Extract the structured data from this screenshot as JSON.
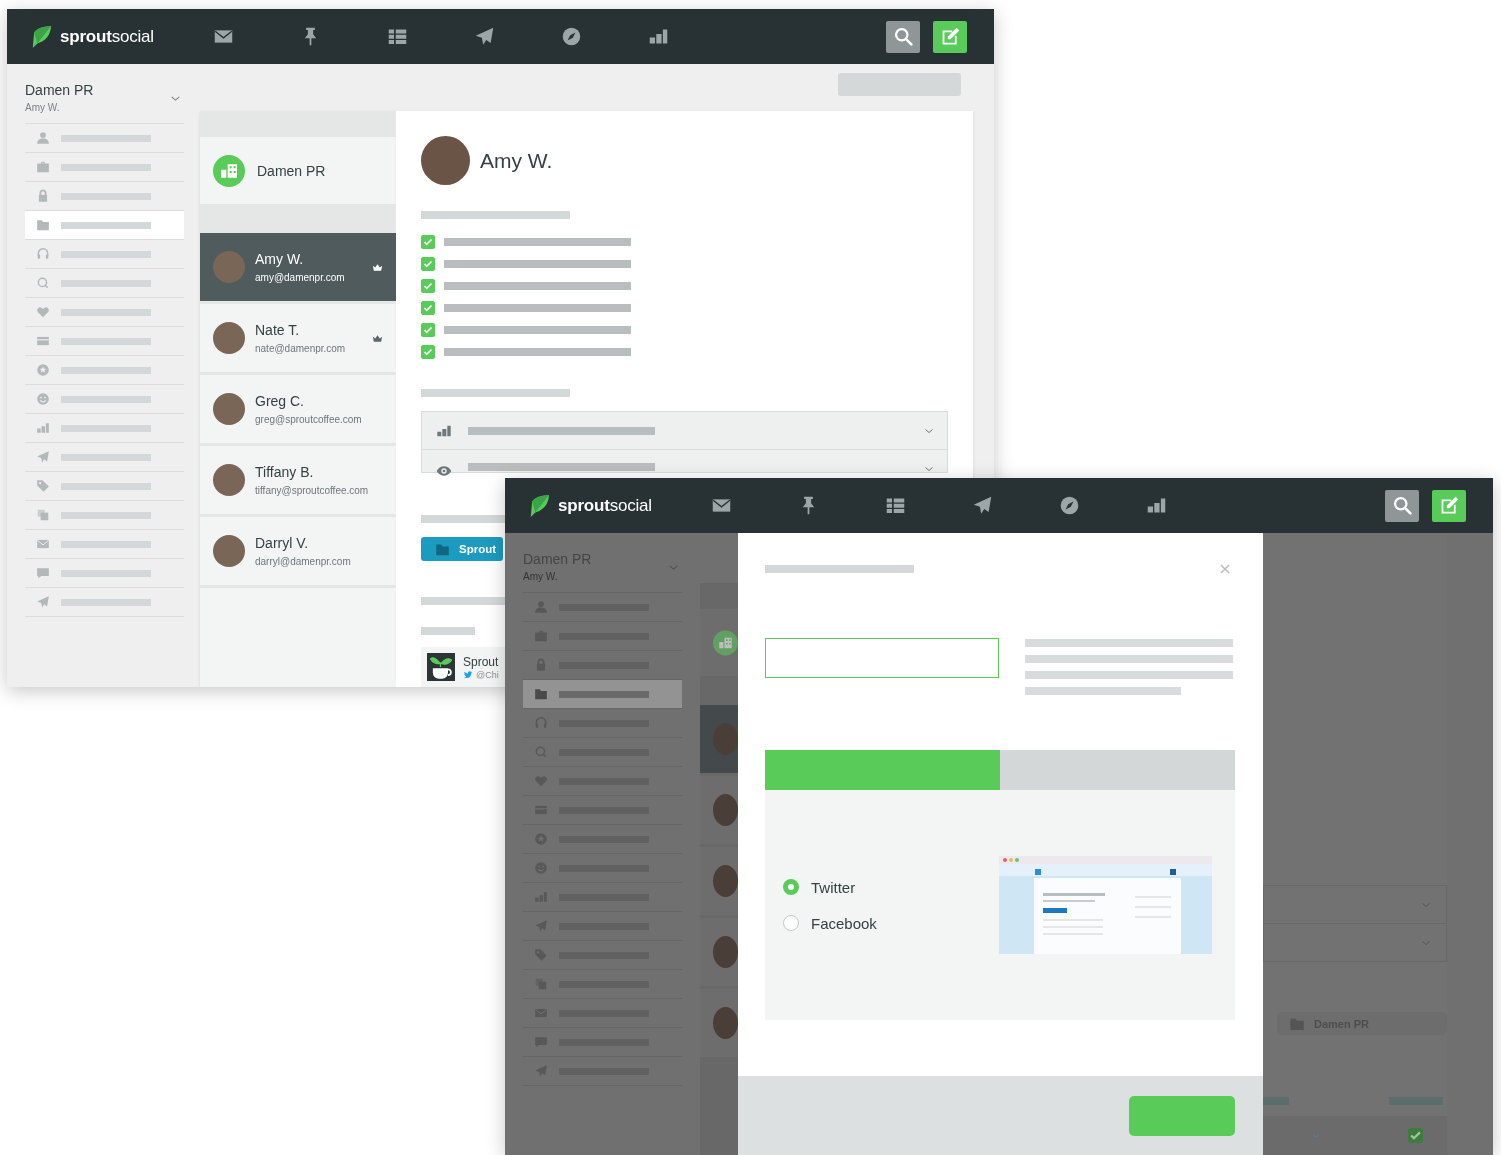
{
  "window_back": {
    "logo": "**sprout**social",
    "account": {
      "name": "Damen PR",
      "user": "Amy W."
    },
    "sidebar_items": [
      {
        "selected": false
      },
      {
        "selected": false
      },
      {
        "selected": false
      },
      {
        "selected": true
      },
      {
        "selected": false
      },
      {
        "selected": false
      },
      {
        "selected": false
      },
      {
        "selected": false
      },
      {
        "selected": false
      },
      {
        "selected": false
      },
      {
        "selected": false
      },
      {
        "selected": false
      },
      {
        "selected": false
      },
      {
        "selected": false
      },
      {
        "selected": false
      },
      {
        "selected": false
      },
      {
        "selected": false
      }
    ],
    "group": {
      "name": "Damen PR"
    },
    "users": [
      {
        "name": "Amy W.",
        "email": "amy@damenpr.com",
        "owner": true,
        "selected": true
      },
      {
        "name": "Nate T.",
        "email": "nate@damenpr.com",
        "owner": true,
        "selected": false
      },
      {
        "name": "Greg C.",
        "email": "greg@sproutcoffee.com",
        "owner": false,
        "selected": false
      },
      {
        "name": "Tiffany B.",
        "email": "tiffany@sproutcoffee.com",
        "owner": false,
        "selected": false
      },
      {
        "name": "Darryl V.",
        "email": "darryl@damenpr.com",
        "owner": false,
        "selected": false
      }
    ],
    "profile": {
      "name": "Amy W.",
      "permissions": [
        {
          "checked": true
        },
        {
          "checked": true
        },
        {
          "checked": true
        },
        {
          "checked": true
        },
        {
          "checked": true
        },
        {
          "checked": true
        }
      ]
    },
    "folder_button": "Sprout",
    "profile_card": {
      "name": "Sprout",
      "handle": "@Chi"
    }
  },
  "window_front": {
    "logo": "**sprout**social",
    "account": {
      "name": "Damen PR",
      "user": "Amy W."
    },
    "sidebar_items": [
      {
        "selected": false
      },
      {
        "selected": false
      },
      {
        "selected": false
      },
      {
        "selected": true
      },
      {
        "selected": false
      },
      {
        "selected": false
      },
      {
        "selected": false
      },
      {
        "selected": false
      },
      {
        "selected": false
      },
      {
        "selected": false
      },
      {
        "selected": false
      },
      {
        "selected": false
      },
      {
        "selected": false
      },
      {
        "selected": false
      },
      {
        "selected": false
      },
      {
        "selected": false
      },
      {
        "selected": false
      }
    ],
    "users": [
      {
        "selected": true
      },
      {
        "selected": false
      },
      {
        "selected": false
      },
      {
        "selected": false
      },
      {
        "selected": false
      }
    ],
    "folder_tag": "Damen PR",
    "checkbox": {
      "checked": true
    },
    "modal": {
      "progress": {
        "level": 0.5
      },
      "networks": [
        {
          "label": "Twitter",
          "selected": true
        },
        {
          "label": "Facebook",
          "selected": false
        }
      ]
    }
  }
}
